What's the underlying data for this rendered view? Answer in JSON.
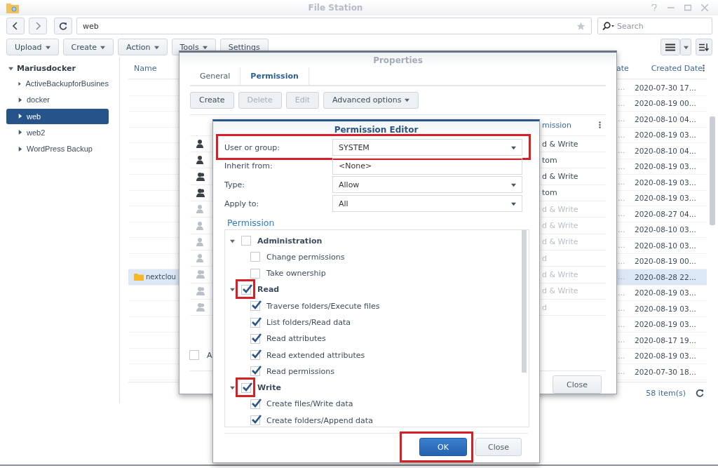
{
  "window": {
    "title": "File Station"
  },
  "path": {
    "value": "web"
  },
  "search": {
    "placeholder": "Search"
  },
  "toolbar": [
    {
      "label": "Upload",
      "menu": true
    },
    {
      "label": "Create",
      "menu": true
    },
    {
      "label": "Action",
      "menu": true
    },
    {
      "label": "Tools",
      "menu": true
    },
    {
      "label": "Settings",
      "menu": false
    }
  ],
  "sidebar": {
    "label": "Mariusdocker",
    "expanded": true,
    "children": [
      {
        "label": "ActiveBackupforBusines",
        "expanded": false,
        "selected": false
      },
      {
        "label": "docker",
        "expanded": false,
        "selected": false
      },
      {
        "label": "web",
        "expanded": false,
        "selected": true
      },
      {
        "label": "web2",
        "expanded": false,
        "selected": false
      },
      {
        "label": "WordPress Backup",
        "expanded": false,
        "selected": false
      }
    ]
  },
  "file_list": {
    "columns": [
      {
        "label": "Name"
      },
      {
        "label": "ate"
      },
      {
        "label": "Created Date"
      }
    ],
    "rows": [
      {
        "modified": "...",
        "created": "2020-07-30 17...",
        "selected": false
      },
      {
        "modified": "...",
        "created": "2020-08-19 00...",
        "selected": false
      },
      {
        "modified": "...",
        "created": "2020-08-10 04...",
        "selected": false
      },
      {
        "modified": "...",
        "created": "2020-08-19 03...",
        "selected": false
      },
      {
        "modified": "...",
        "created": "2020-08-10 04...",
        "selected": false
      },
      {
        "modified": "...",
        "created": "2020-08-19 03...",
        "selected": false
      },
      {
        "modified": "...",
        "created": "2020-08-19 03...",
        "selected": false
      },
      {
        "modified": "...",
        "created": "2020-08-19 03...",
        "selected": false
      },
      {
        "modified": "...",
        "created": "2020-08-27 04...",
        "selected": false
      },
      {
        "modified": "...",
        "created": "2020-08-10 03...",
        "selected": false
      },
      {
        "modified": "...",
        "created": "2020-08-10 03...",
        "selected": false
      },
      {
        "modified": "...",
        "created": "2020-08-19 00...",
        "selected": false
      },
      {
        "name": "nextclou",
        "modified": "...",
        "created": "2020-08-28 22...",
        "selected": true
      },
      {
        "modified": "...",
        "created": "2020-08-19 03...",
        "selected": false
      },
      {
        "modified": "...",
        "created": "2020-08-19 03...",
        "selected": false
      },
      {
        "modified": "...",
        "created": "2020-08-19 03...",
        "selected": false
      },
      {
        "modified": "...",
        "created": "2020-08-17 19...",
        "selected": false
      },
      {
        "modified": "...",
        "created": "2020-08-19 03...",
        "selected": false
      },
      {
        "modified": "...",
        "created": "2020-07-30 18...",
        "selected": false
      }
    ],
    "count": "58 item(s)"
  },
  "properties": {
    "title": "Properties",
    "tabs": [
      {
        "label": "General",
        "selected": false
      },
      {
        "label": "Permission",
        "selected": true
      }
    ],
    "buttons": [
      {
        "label": "Create",
        "disabled": false,
        "menu": false
      },
      {
        "label": "Delete",
        "disabled": true,
        "menu": false
      },
      {
        "label": "Edit",
        "disabled": true,
        "menu": false
      },
      {
        "label": "Advanced options",
        "disabled": false,
        "menu": true
      }
    ],
    "column": "mission",
    "rows": [
      {
        "kind": "user",
        "inherited": false,
        "permission": "d & Write"
      },
      {
        "kind": "user",
        "inherited": false,
        "permission": "tom"
      },
      {
        "kind": "group",
        "inherited": false,
        "permission": "d & Write"
      },
      {
        "kind": "group",
        "inherited": false,
        "permission": "tom"
      },
      {
        "kind": "user",
        "inherited": true,
        "permission": "d & Write"
      },
      {
        "kind": "user",
        "inherited": true,
        "permission": "d & Write"
      },
      {
        "kind": "user",
        "inherited": true,
        "permission": "d & Write"
      },
      {
        "kind": "user",
        "inherited": true,
        "permission": "d"
      },
      {
        "kind": "group",
        "inherited": true,
        "permission": "d & Write"
      },
      {
        "kind": "group",
        "inherited": true,
        "permission": "d & Write"
      },
      {
        "kind": "group",
        "inherited": true,
        "permission": "d"
      }
    ],
    "option": {
      "label": "A",
      "checked": false
    },
    "close": "Close"
  },
  "permission_editor": {
    "title": "Permission Editor",
    "fields": [
      {
        "label": "User or group:",
        "value": "SYSTEM",
        "dropdown": true,
        "highlighted": true
      },
      {
        "label": "Inherit from:",
        "value": "<None>",
        "dropdown": false,
        "highlighted": false
      },
      {
        "label": "Type:",
        "value": "Allow",
        "dropdown": true,
        "highlighted": false
      },
      {
        "label": "Apply to:",
        "value": "All",
        "dropdown": true,
        "highlighted": false
      }
    ],
    "section": "Permission",
    "tree": [
      {
        "label": "Administration",
        "checked": false,
        "expanded": true,
        "highlighted": false,
        "children": [
          {
            "label": "Change permissions",
            "checked": false
          },
          {
            "label": "Take ownership",
            "checked": false
          }
        ]
      },
      {
        "label": "Read",
        "checked": true,
        "expanded": true,
        "highlighted": true,
        "children": [
          {
            "label": "Traverse folders/Execute files",
            "checked": true
          },
          {
            "label": "List folders/Read data",
            "checked": true
          },
          {
            "label": "Read attributes",
            "checked": true
          },
          {
            "label": "Read extended attributes",
            "checked": true
          },
          {
            "label": "Read permissions",
            "checked": true
          }
        ]
      },
      {
        "label": "Write",
        "checked": true,
        "expanded": true,
        "highlighted": true,
        "children": [
          {
            "label": "Create files/Write data",
            "checked": true
          },
          {
            "label": "Create folders/Append data",
            "checked": true
          }
        ]
      }
    ],
    "buttons": [
      {
        "label": "OK",
        "kind": "primary",
        "highlighted": true
      },
      {
        "label": "Close",
        "kind": "plain",
        "highlighted": false
      }
    ]
  }
}
